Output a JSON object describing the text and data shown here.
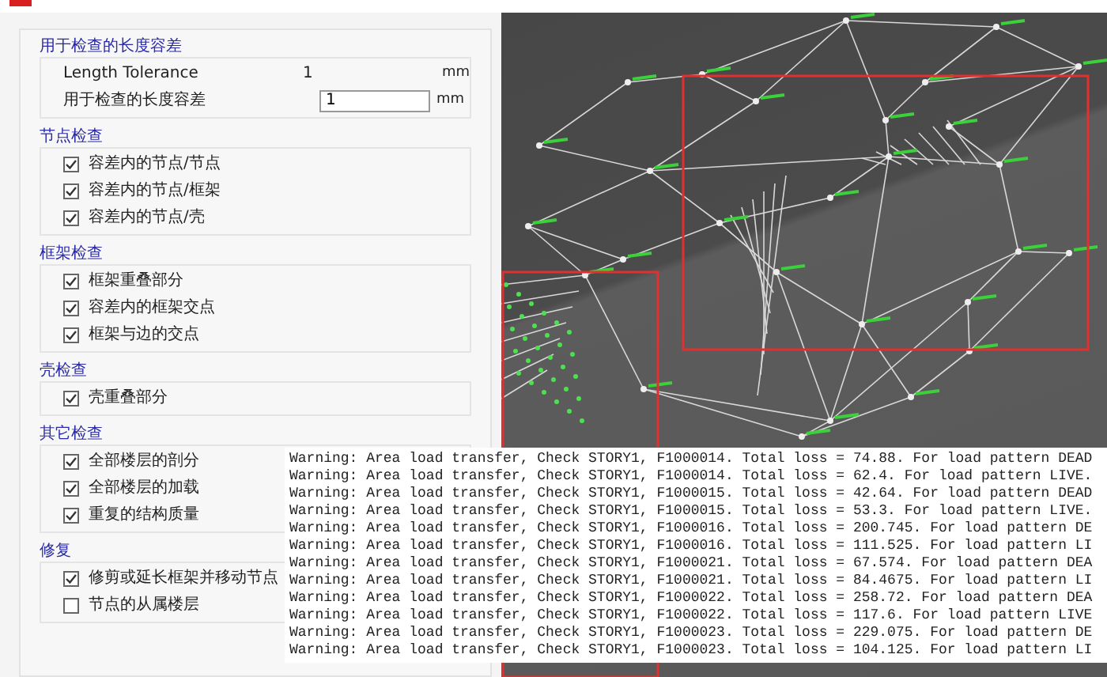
{
  "panel": {
    "groups": [
      {
        "title": "用于检查的长度容差",
        "rows": [
          {
            "kind": "readout",
            "label": "Length Tolerance",
            "value": "1",
            "unit": "mm"
          },
          {
            "kind": "input",
            "label": "用于检查的长度容差",
            "value": "1",
            "unit": "mm"
          }
        ]
      },
      {
        "title": "节点检查",
        "rows": [
          {
            "kind": "check",
            "label": "容差内的节点/节点",
            "checked": true
          },
          {
            "kind": "check",
            "label": "容差内的节点/框架",
            "checked": true
          },
          {
            "kind": "check",
            "label": "容差内的节点/壳",
            "checked": true
          }
        ]
      },
      {
        "title": "框架检查",
        "rows": [
          {
            "kind": "check",
            "label": "框架重叠部分",
            "checked": true
          },
          {
            "kind": "check",
            "label": "容差内的框架交点",
            "checked": true
          },
          {
            "kind": "check",
            "label": "框架与边的交点",
            "checked": true
          }
        ]
      },
      {
        "title": "壳检查",
        "rows": [
          {
            "kind": "check",
            "label": "壳重叠部分",
            "checked": true
          }
        ]
      },
      {
        "title": "其它检查",
        "rows": [
          {
            "kind": "check",
            "label": "全部楼层的剖分",
            "checked": true
          },
          {
            "kind": "check",
            "label": "全部楼层的加载",
            "checked": true
          },
          {
            "kind": "check",
            "label": "重复的结构质量",
            "checked": true
          }
        ]
      },
      {
        "title": "修复",
        "rows": [
          {
            "kind": "check",
            "label": "修剪或延长框架并移动节点",
            "checked": true
          },
          {
            "kind": "check",
            "label": "节点的从属楼层",
            "checked": false
          }
        ]
      }
    ]
  },
  "log": {
    "lines": [
      "Warning: Area load transfer, Check STORY1, F1000014. Total loss = 74.88. For load pattern DEAD",
      "Warning: Area load transfer, Check STORY1, F1000014. Total loss = 62.4. For load pattern LIVE.",
      "Warning: Area load transfer, Check STORY1, F1000015. Total loss = 42.64. For load pattern DEAD",
      "Warning: Area load transfer, Check STORY1, F1000015. Total loss = 53.3. For load pattern LIVE.",
      "Warning: Area load transfer, Check STORY1, F1000016. Total loss = 200.745. For load pattern DE",
      "Warning: Area load transfer, Check STORY1, F1000016. Total loss = 111.525. For load pattern LI",
      "Warning: Area load transfer, Check STORY1, F1000021. Total loss = 67.574. For load pattern DEA",
      "Warning: Area load transfer, Check STORY1, F1000021. Total loss = 84.4675. For load pattern LI",
      "Warning: Area load transfer, Check STORY1, F1000022. Total loss = 258.72. For load pattern DEA",
      "Warning: Area load transfer, Check STORY1, F1000022. Total loss = 117.6. For load pattern LIVE",
      "Warning: Area load transfer, Check STORY1, F1000023. Total loss = 229.075. For load pattern DE",
      "Warning: Area load transfer, Check STORY1, F1000023. Total loss = 104.125. For load pattern LI"
    ]
  }
}
